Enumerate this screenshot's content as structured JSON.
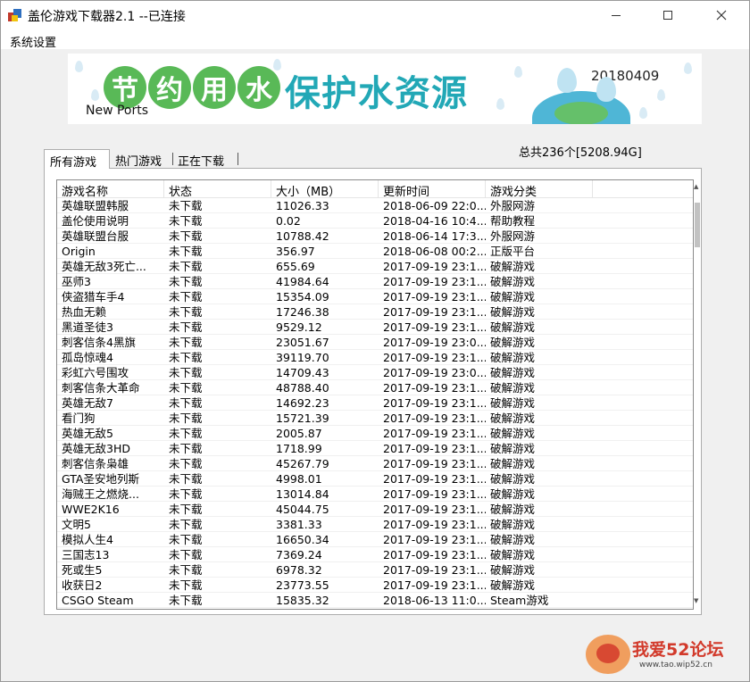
{
  "window": {
    "title": "盖伦游戏下载器2.1 --已连接",
    "menu": [
      "系统设置"
    ]
  },
  "banner": {
    "chars": [
      "节",
      "约",
      "用",
      "水"
    ],
    "slogan": "保护水资源",
    "date": "20180409",
    "subtitle": "New Ports",
    "colors": {
      "circle": "#59b957",
      "slogan": "#22a8b6"
    }
  },
  "tabs": [
    {
      "label": "所有游戏",
      "active": true
    },
    {
      "label": "热门游戏",
      "active": false
    },
    {
      "label": "正在下载",
      "active": false
    }
  ],
  "summary": "总共236个[5208.94G]",
  "table": {
    "columns": [
      "游戏名称",
      "状态",
      "大小（MB）",
      "更新时间",
      "游戏分类",
      ""
    ],
    "rows": [
      [
        "英雄联盟韩服",
        "未下载",
        "11026.33",
        "2018-06-09 22:0...",
        "外服网游"
      ],
      [
        "盖伦使用说明",
        "未下载",
        "0.02",
        "2018-04-16 10:4...",
        "帮助教程"
      ],
      [
        "英雄联盟台服",
        "未下载",
        "10788.42",
        "2018-06-14 17:3...",
        "外服网游"
      ],
      [
        "Origin",
        "未下载",
        "356.97",
        "2018-06-08 00:2...",
        "正版平台"
      ],
      [
        "英雄无敌3死亡...",
        "未下载",
        "655.69",
        "2017-09-19 23:1...",
        "破解游戏"
      ],
      [
        "巫师3",
        "未下载",
        "41984.64",
        "2017-09-19 23:1...",
        "破解游戏"
      ],
      [
        "侠盗猎车手4",
        "未下载",
        "15354.09",
        "2017-09-19 23:1...",
        "破解游戏"
      ],
      [
        "热血无赖",
        "未下载",
        "17246.38",
        "2017-09-19 23:1...",
        "破解游戏"
      ],
      [
        "黑道圣徒3",
        "未下载",
        "9529.12",
        "2017-09-19 23:1...",
        "破解游戏"
      ],
      [
        "刺客信条4黑旗",
        "未下载",
        "23051.67",
        "2017-09-19 23:0...",
        "破解游戏"
      ],
      [
        "孤岛惊魂4",
        "未下载",
        "39119.70",
        "2017-09-19 23:1...",
        "破解游戏"
      ],
      [
        "彩虹六号围攻",
        "未下载",
        "14709.43",
        "2017-09-19 23:0...",
        "破解游戏"
      ],
      [
        "刺客信条大革命",
        "未下载",
        "48788.40",
        "2017-09-19 23:1...",
        "破解游戏"
      ],
      [
        "英雄无敌7",
        "未下载",
        "14692.23",
        "2017-09-19 23:1...",
        "破解游戏"
      ],
      [
        "看门狗",
        "未下载",
        "15721.39",
        "2017-09-19 23:1...",
        "破解游戏"
      ],
      [
        "英雄无敌5",
        "未下载",
        "2005.87",
        "2017-09-19 23:1...",
        "破解游戏"
      ],
      [
        "英雄无敌3HD",
        "未下载",
        "1718.99",
        "2017-09-19 23:1...",
        "破解游戏"
      ],
      [
        "刺客信条枭雄",
        "未下载",
        "45267.79",
        "2017-09-19 23:1...",
        "破解游戏"
      ],
      [
        "GTA圣安地列斯",
        "未下载",
        "4998.01",
        "2017-09-19 23:1...",
        "破解游戏"
      ],
      [
        "海贼王之燃烧...",
        "未下载",
        "13014.84",
        "2017-09-19 23:1...",
        "破解游戏"
      ],
      [
        "WWE2K16",
        "未下载",
        "45044.75",
        "2017-09-19 23:1...",
        "破解游戏"
      ],
      [
        "文明5",
        "未下载",
        "3381.33",
        "2017-09-19 23:1...",
        "破解游戏"
      ],
      [
        "模拟人生4",
        "未下载",
        "16650.34",
        "2017-09-19 23:1...",
        "破解游戏"
      ],
      [
        "三国志13",
        "未下载",
        "7369.24",
        "2017-09-19 23:1...",
        "破解游戏"
      ],
      [
        "死或生5",
        "未下载",
        "6978.32",
        "2017-09-19 23:1...",
        "破解游戏"
      ],
      [
        "收获日2",
        "未下载",
        "23773.55",
        "2017-09-19 23:1...",
        "破解游戏"
      ],
      [
        "CSGO Steam",
        "未下载",
        "15835.32",
        "2018-06-13 11:0...",
        "Steam游戏"
      ]
    ]
  },
  "watermark": {
    "text": "我爱52论坛",
    "url": "www.tao.wip52.cn"
  }
}
